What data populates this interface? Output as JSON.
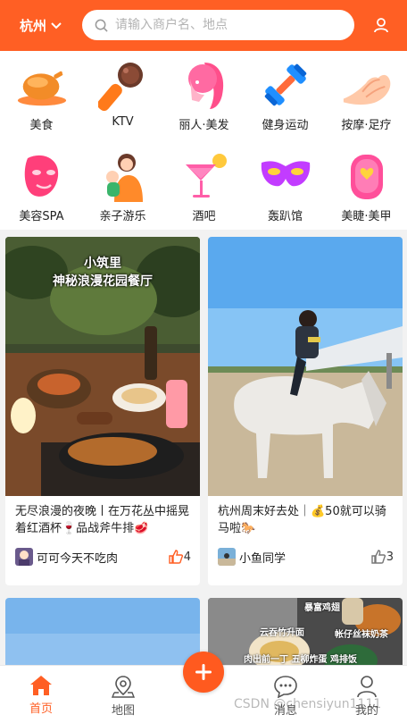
{
  "header": {
    "city": "杭州",
    "search_placeholder": "请输入商户名、地点"
  },
  "categories": [
    {
      "label": "美食",
      "icon": "roast-chicken-icon"
    },
    {
      "label": "KTV",
      "icon": "microphone-icon"
    },
    {
      "label": "丽人·美发",
      "icon": "hair-woman-icon"
    },
    {
      "label": "健身运动",
      "icon": "dumbbell-icon"
    },
    {
      "label": "按摩·足疗",
      "icon": "massage-hand-icon"
    },
    {
      "label": "美容SPA",
      "icon": "face-mask-icon"
    },
    {
      "label": "亲子游乐",
      "icon": "parent-child-icon"
    },
    {
      "label": "酒吧",
      "icon": "cocktail-icon"
    },
    {
      "label": "轰趴馆",
      "icon": "party-mask-icon"
    },
    {
      "label": "美睫·美甲",
      "icon": "nail-icon"
    }
  ],
  "feed": [
    {
      "image_caption_line1": "小筑里",
      "image_caption_line2": "神秘浪漫花园餐厅",
      "title": "无尽浪漫的夜晚丨在万花丛中摇晃着红酒杯🍷品战斧牛排🥩",
      "author": "可可今天不吃肉",
      "likes": "4"
    },
    {
      "title": "杭州周末好去处｜💰50就可以骑马啦🐎",
      "author": "小鱼同学",
      "likes": "3"
    },
    {
      "image_caption": ""
    },
    {
      "image_caption_line1": "暴富鸡翅",
      "image_caption_line2": "云吞竹升面",
      "image_caption_line3": "帐仔丝袜奶茶",
      "image_caption_line4": "肉出前一丁 五柳炸蛋 鸡排饭"
    }
  ],
  "tabbar": {
    "home": "首页",
    "map": "地图",
    "messages": "消息",
    "mine": "我的"
  },
  "watermark": "CSDN @chensiyun1111",
  "colors": {
    "brand": "#ff5f24"
  }
}
